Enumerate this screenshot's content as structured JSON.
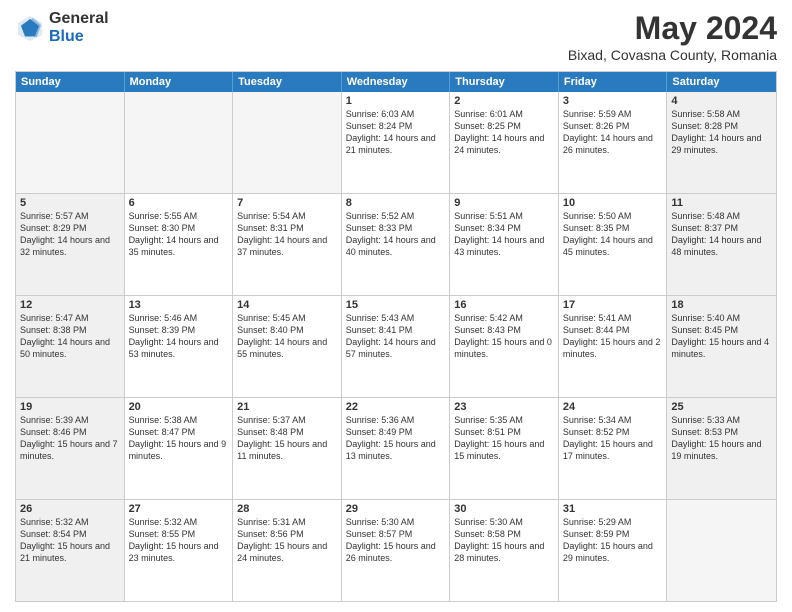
{
  "header": {
    "logo_general": "General",
    "logo_blue": "Blue",
    "month_year": "May 2024",
    "location": "Bixad, Covasna County, Romania"
  },
  "weekdays": [
    "Sunday",
    "Monday",
    "Tuesday",
    "Wednesday",
    "Thursday",
    "Friday",
    "Saturday"
  ],
  "rows": [
    [
      {
        "day": "",
        "text": "",
        "empty": true
      },
      {
        "day": "",
        "text": "",
        "empty": true
      },
      {
        "day": "",
        "text": "",
        "empty": true
      },
      {
        "day": "1",
        "text": "Sunrise: 6:03 AM\nSunset: 8:24 PM\nDaylight: 14 hours\nand 21 minutes."
      },
      {
        "day": "2",
        "text": "Sunrise: 6:01 AM\nSunset: 8:25 PM\nDaylight: 14 hours\nand 24 minutes."
      },
      {
        "day": "3",
        "text": "Sunrise: 5:59 AM\nSunset: 8:26 PM\nDaylight: 14 hours\nand 26 minutes."
      },
      {
        "day": "4",
        "text": "Sunrise: 5:58 AM\nSunset: 8:28 PM\nDaylight: 14 hours\nand 29 minutes.",
        "shaded": true
      }
    ],
    [
      {
        "day": "5",
        "text": "Sunrise: 5:57 AM\nSunset: 8:29 PM\nDaylight: 14 hours\nand 32 minutes.",
        "shaded": true
      },
      {
        "day": "6",
        "text": "Sunrise: 5:55 AM\nSunset: 8:30 PM\nDaylight: 14 hours\nand 35 minutes."
      },
      {
        "day": "7",
        "text": "Sunrise: 5:54 AM\nSunset: 8:31 PM\nDaylight: 14 hours\nand 37 minutes."
      },
      {
        "day": "8",
        "text": "Sunrise: 5:52 AM\nSunset: 8:33 PM\nDaylight: 14 hours\nand 40 minutes."
      },
      {
        "day": "9",
        "text": "Sunrise: 5:51 AM\nSunset: 8:34 PM\nDaylight: 14 hours\nand 43 minutes."
      },
      {
        "day": "10",
        "text": "Sunrise: 5:50 AM\nSunset: 8:35 PM\nDaylight: 14 hours\nand 45 minutes."
      },
      {
        "day": "11",
        "text": "Sunrise: 5:48 AM\nSunset: 8:37 PM\nDaylight: 14 hours\nand 48 minutes.",
        "shaded": true
      }
    ],
    [
      {
        "day": "12",
        "text": "Sunrise: 5:47 AM\nSunset: 8:38 PM\nDaylight: 14 hours\nand 50 minutes.",
        "shaded": true
      },
      {
        "day": "13",
        "text": "Sunrise: 5:46 AM\nSunset: 8:39 PM\nDaylight: 14 hours\nand 53 minutes."
      },
      {
        "day": "14",
        "text": "Sunrise: 5:45 AM\nSunset: 8:40 PM\nDaylight: 14 hours\nand 55 minutes."
      },
      {
        "day": "15",
        "text": "Sunrise: 5:43 AM\nSunset: 8:41 PM\nDaylight: 14 hours\nand 57 minutes."
      },
      {
        "day": "16",
        "text": "Sunrise: 5:42 AM\nSunset: 8:43 PM\nDaylight: 15 hours\nand 0 minutes."
      },
      {
        "day": "17",
        "text": "Sunrise: 5:41 AM\nSunset: 8:44 PM\nDaylight: 15 hours\nand 2 minutes."
      },
      {
        "day": "18",
        "text": "Sunrise: 5:40 AM\nSunset: 8:45 PM\nDaylight: 15 hours\nand 4 minutes.",
        "shaded": true
      }
    ],
    [
      {
        "day": "19",
        "text": "Sunrise: 5:39 AM\nSunset: 8:46 PM\nDaylight: 15 hours\nand 7 minutes.",
        "shaded": true
      },
      {
        "day": "20",
        "text": "Sunrise: 5:38 AM\nSunset: 8:47 PM\nDaylight: 15 hours\nand 9 minutes."
      },
      {
        "day": "21",
        "text": "Sunrise: 5:37 AM\nSunset: 8:48 PM\nDaylight: 15 hours\nand 11 minutes."
      },
      {
        "day": "22",
        "text": "Sunrise: 5:36 AM\nSunset: 8:49 PM\nDaylight: 15 hours\nand 13 minutes."
      },
      {
        "day": "23",
        "text": "Sunrise: 5:35 AM\nSunset: 8:51 PM\nDaylight: 15 hours\nand 15 minutes."
      },
      {
        "day": "24",
        "text": "Sunrise: 5:34 AM\nSunset: 8:52 PM\nDaylight: 15 hours\nand 17 minutes."
      },
      {
        "day": "25",
        "text": "Sunrise: 5:33 AM\nSunset: 8:53 PM\nDaylight: 15 hours\nand 19 minutes.",
        "shaded": true
      }
    ],
    [
      {
        "day": "26",
        "text": "Sunrise: 5:32 AM\nSunset: 8:54 PM\nDaylight: 15 hours\nand 21 minutes.",
        "shaded": true
      },
      {
        "day": "27",
        "text": "Sunrise: 5:32 AM\nSunset: 8:55 PM\nDaylight: 15 hours\nand 23 minutes."
      },
      {
        "day": "28",
        "text": "Sunrise: 5:31 AM\nSunset: 8:56 PM\nDaylight: 15 hours\nand 24 minutes."
      },
      {
        "day": "29",
        "text": "Sunrise: 5:30 AM\nSunset: 8:57 PM\nDaylight: 15 hours\nand 26 minutes."
      },
      {
        "day": "30",
        "text": "Sunrise: 5:30 AM\nSunset: 8:58 PM\nDaylight: 15 hours\nand 28 minutes."
      },
      {
        "day": "31",
        "text": "Sunrise: 5:29 AM\nSunset: 8:59 PM\nDaylight: 15 hours\nand 29 minutes."
      },
      {
        "day": "",
        "text": "",
        "empty": true
      }
    ]
  ]
}
